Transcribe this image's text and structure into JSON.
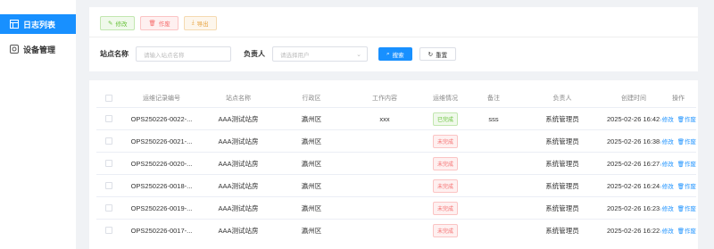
{
  "sidebar": {
    "items": [
      {
        "label": "日志列表",
        "icon": "list-icon",
        "active": true
      },
      {
        "label": "设备管理",
        "icon": "device-icon",
        "active": false
      }
    ]
  },
  "toolbar": {
    "edit_label": "修改",
    "void_label": "作废",
    "export_label": "导出"
  },
  "search": {
    "station_label": "站点名称",
    "station_placeholder": "请输入站点名称",
    "owner_label": "负责人",
    "owner_placeholder": "请选择用户",
    "search_label": "搜索",
    "reset_label": "重置"
  },
  "table": {
    "headers": [
      "运维记录编号",
      "站点名称",
      "行政区",
      "工作内容",
      "运维情况",
      "备注",
      "负责人",
      "创建时间",
      "操作"
    ],
    "rows": [
      {
        "id": "OPS250226-0022-...",
        "station": "AAA测试站房",
        "district": "瀛州区",
        "content": "xxx",
        "status": "已完成",
        "status_type": "done",
        "remark": "sss",
        "owner": "系统管理员",
        "created": "2025-02-26 16:42:...",
        "op_edit": "修改",
        "op_void": "作废"
      },
      {
        "id": "OPS250226-0021-...",
        "station": "AAA测试站房",
        "district": "瀛州区",
        "content": "",
        "status": "未完成",
        "status_type": "todo",
        "remark": "",
        "owner": "系统管理员",
        "created": "2025-02-26 16:38:...",
        "op_edit": "修改",
        "op_void": "作废"
      },
      {
        "id": "OPS250226-0020-...",
        "station": "AAA测试站房",
        "district": "瀛州区",
        "content": "",
        "status": "未完成",
        "status_type": "todo",
        "remark": "",
        "owner": "系统管理员",
        "created": "2025-02-26 16:27:...",
        "op_edit": "修改",
        "op_void": "作废"
      },
      {
        "id": "OPS250226-0018-...",
        "station": "AAA测试站房",
        "district": "瀛州区",
        "content": "",
        "status": "未完成",
        "status_type": "todo",
        "remark": "",
        "owner": "系统管理员",
        "created": "2025-02-26 16:24:...",
        "op_edit": "修改",
        "op_void": "作废"
      },
      {
        "id": "OPS250226-0019-...",
        "station": "AAA测试站房",
        "district": "瀛州区",
        "content": "",
        "status": "未完成",
        "status_type": "todo",
        "remark": "",
        "owner": "系统管理员",
        "created": "2025-02-26 16:23:...",
        "op_edit": "修改",
        "op_void": "作废"
      },
      {
        "id": "OPS250226-0017-...",
        "station": "AAA测试站房",
        "district": "瀛州区",
        "content": "",
        "status": "未完成",
        "status_type": "todo",
        "remark": "",
        "owner": "系统管理员",
        "created": "2025-02-26 16:22:...",
        "op_edit": "修改",
        "op_void": "作废"
      }
    ]
  },
  "colors": {
    "primary": "#1890ff",
    "success": "#67c23a",
    "danger": "#f56c6c",
    "warning": "#e6a23c"
  }
}
